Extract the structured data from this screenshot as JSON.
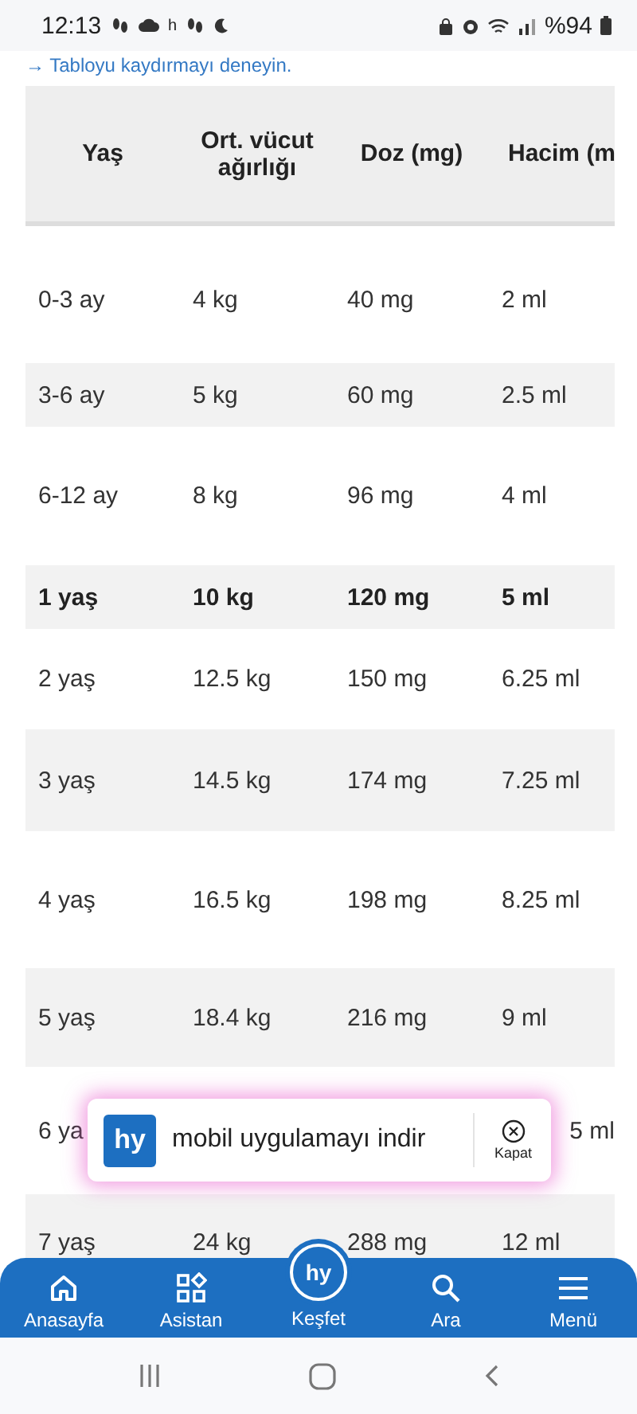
{
  "status_bar": {
    "time": "12:13",
    "notification_letter": "h",
    "battery": "%94"
  },
  "hint": "→ Tabloyu kaydırmayı deneyin.",
  "table": {
    "columns": [
      "Yaş",
      "Ort. vücut ağırlığı",
      "Doz (mg)",
      "Hacim (m"
    ],
    "rows": [
      {
        "cells": [
          "0-3 ay",
          "4 kg",
          "40 mg",
          "2 ml"
        ],
        "bold": false
      },
      {
        "cells": [
          "3-6 ay",
          "5 kg",
          "60 mg",
          "2.5 ml"
        ],
        "bold": false
      },
      {
        "cells": [
          "6-12 ay",
          "8 kg",
          "96 mg",
          "4 ml"
        ],
        "bold": false
      },
      {
        "cells": [
          "1 yaş",
          "10 kg",
          "120 mg",
          "5 ml"
        ],
        "bold": true
      },
      {
        "cells": [
          "2 yaş",
          "12.5 kg",
          "150 mg",
          "6.25 ml"
        ],
        "bold": false
      },
      {
        "cells": [
          "3 yaş",
          "14.5 kg",
          "174 mg",
          "7.25 ml"
        ],
        "bold": false
      },
      {
        "cells": [
          "4 yaş",
          "16.5 kg",
          "198 mg",
          "8.25 ml"
        ],
        "bold": false
      },
      {
        "cells": [
          "5 yaş",
          "18.4 kg",
          "216 mg",
          "9 ml"
        ],
        "bold": false
      },
      {
        "cells": [
          "6 ya",
          null,
          null,
          "5 ml"
        ],
        "bold": false
      },
      {
        "cells": [
          "7 yaş",
          "24 kg",
          "288 mg",
          "12 ml"
        ],
        "bold": false
      }
    ]
  },
  "popup": {
    "logo": "hy",
    "text": "mobil uygulamayı indir",
    "close_label": "Kapat"
  },
  "bottom_nav": [
    {
      "kind": "tab",
      "label": "Anasayfa"
    },
    {
      "kind": "tab",
      "label": "Asistan"
    },
    {
      "kind": "raised",
      "logo": "hy",
      "label": "Keşfet"
    },
    {
      "kind": "tab",
      "label": "Ara"
    },
    {
      "kind": "tab",
      "label": "Menü"
    }
  ]
}
